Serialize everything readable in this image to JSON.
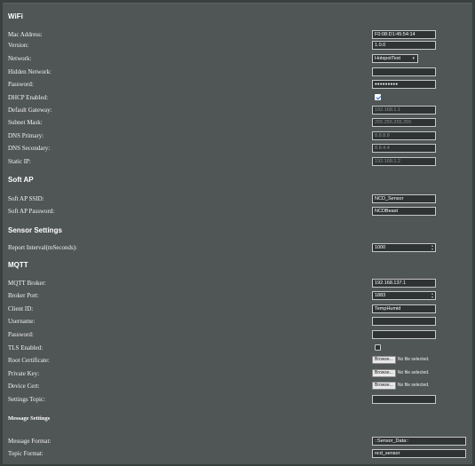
{
  "wifi": {
    "header": "WiFi",
    "mac_label": "Mac Address:",
    "mac_value": "F0:08:D1:45:54:14",
    "version_label": "Version:",
    "version_value": "1.0.0",
    "network_label": "Network:",
    "network_value": "HotspotTest",
    "hidden_label": "Hidden Network:",
    "hidden_value": "",
    "password_label": "Password:",
    "password_value": "●●●●●●●●●",
    "dhcp_label": "DHCP Enabled:",
    "dhcp_checked": true,
    "gateway_label": "Default Gateway:",
    "gateway_placeholder": "192.168.1.1",
    "subnet_label": "Subnet Mask:",
    "subnet_placeholder": "255.255.255.255",
    "dns1_label": "DNS Primary:",
    "dns1_placeholder": "8.8.8.8",
    "dns2_label": "DNS Secondary:",
    "dns2_placeholder": "8.8.4.4",
    "static_label": "Static IP:",
    "static_placeholder": "192.168.1.2"
  },
  "softap": {
    "header": "Soft AP",
    "ssid_label": "Soft AP SSID:",
    "ssid_value": "NCD_Sensor",
    "password_label": "Soft AP Password:",
    "password_value": "NCDBeast"
  },
  "sensor": {
    "header": "Sensor Settings",
    "interval_label": "Report Interval(mSeconds):",
    "interval_value": "1000"
  },
  "mqtt": {
    "header": "MQTT",
    "broker_label": "MQTT Broker:",
    "broker_value": "192.168.137.1",
    "port_label": "Broker Port:",
    "port_value": "1883",
    "client_label": "Client ID:",
    "client_value": "TempHumid",
    "username_label": "Username:",
    "username_value": "",
    "password_label": "Password:",
    "password_value": "",
    "tls_label": "TLS Enabled:",
    "tls_checked": false,
    "root_label": "Root Certificate:",
    "private_label": "Private Key:",
    "device_label": "Device Cert:",
    "browse_label": "Browse...",
    "no_file_label": "No file selected.",
    "settings_topic_label": "Settings Topic:",
    "settings_topic_value": ""
  },
  "message": {
    "header": "Message Settings",
    "format_label": "Message Format:",
    "format_value": "::Sensor_Data::",
    "topic_label": "Topic Format:",
    "topic_value": "ncd_sensor"
  }
}
